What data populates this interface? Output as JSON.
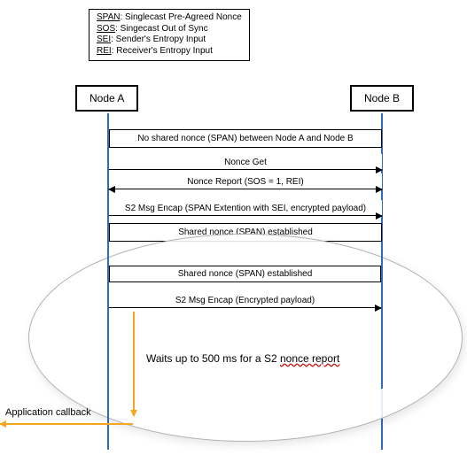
{
  "legend": {
    "span_abbr": "SPAN",
    "span_def": ": Singlecast Pre-Agreed Nonce",
    "sos_abbr": "SOS",
    "sos_def": ": Singecast Out of Sync",
    "sei_abbr": "SEI",
    "sei_def": ": Sender's Entropy Input",
    "rei_abbr": "REI",
    "rei_def": ": Receiver's Entropy Input"
  },
  "nodes": {
    "a": "Node A",
    "b": "Node B"
  },
  "messages": {
    "m1": "No shared nonce (SPAN) between Node A and Node B",
    "m2": "Nonce Get",
    "m3": "Nonce Report (SOS = 1, REI)",
    "m4": "S2 Msg Encap (SPAN Extention with SEI, encrypted payload)",
    "m5": "Shared nonce (SPAN) established"
  },
  "zoom": {
    "z1": "Shared nonce (SPAN) established",
    "z2": "S2 Msg Encap (Encrypted payload)",
    "wait_prefix": "Waits up to 500 ms for a S2 ",
    "wait_nr": "nonce report"
  },
  "callback": "Application callback",
  "colors": {
    "lifeline": "#2e6bb8",
    "highlight": "#f5a623"
  }
}
